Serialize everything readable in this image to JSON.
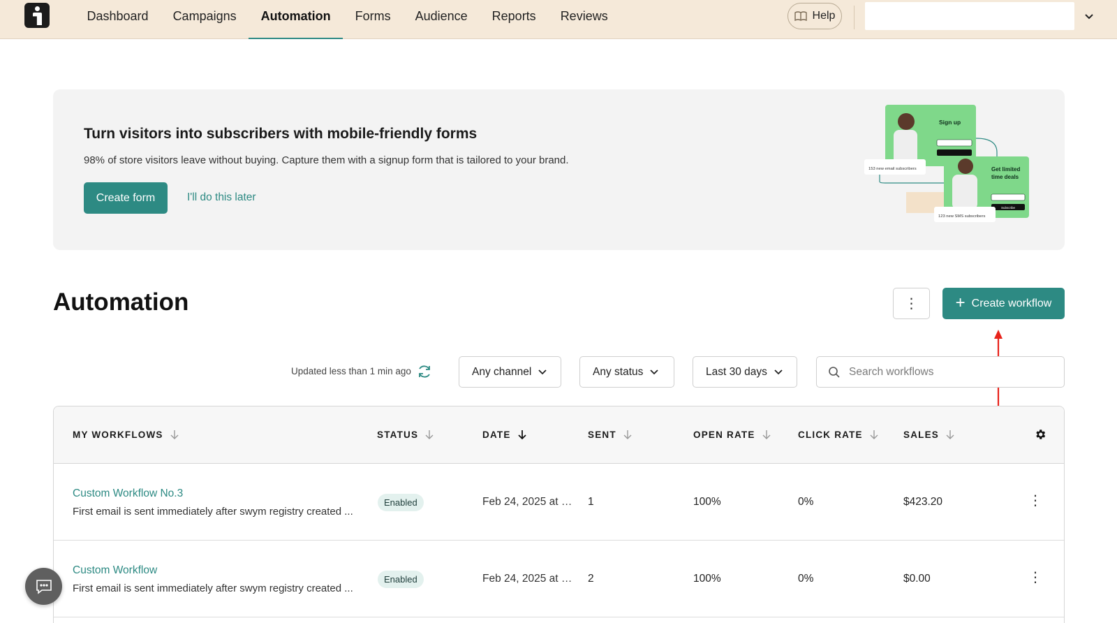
{
  "nav": {
    "items": [
      {
        "label": "Dashboard",
        "active": false
      },
      {
        "label": "Campaigns",
        "active": false
      },
      {
        "label": "Automation",
        "active": true
      },
      {
        "label": "Forms",
        "active": false
      },
      {
        "label": "Audience",
        "active": false
      },
      {
        "label": "Reports",
        "active": false
      },
      {
        "label": "Reviews",
        "active": false
      }
    ],
    "help_label": "Help",
    "accent_color": "#2d8a83"
  },
  "banner": {
    "title": "Turn visitors into subscribers with mobile-friendly forms",
    "text": "98% of store visitors leave without buying. Capture them with a signup form that is tailored to your brand.",
    "primary_button": "Create form",
    "secondary_link": "I'll do this later",
    "promo": {
      "card1_title": "Sign up",
      "card1_stat": "153 new email subscribers",
      "card2_title": "Get limited time deals",
      "card2_stat": "123 new SMS subscribers",
      "card_button": "Subscribe"
    }
  },
  "page": {
    "title": "Automation",
    "more_label": "⋮",
    "create_button": "Create workflow"
  },
  "filters": {
    "updated_text": "Updated less than 1 min ago",
    "channel": "Any channel",
    "status": "Any status",
    "date_range": "Last 30 days",
    "search_placeholder": "Search workflows"
  },
  "table": {
    "headers": {
      "name": "MY WORKFLOWS",
      "status": "STATUS",
      "date": "DATE",
      "sent": "SENT",
      "open_rate": "OPEN RATE",
      "click_rate": "CLICK RATE",
      "sales": "SALES"
    },
    "rows": [
      {
        "name": "Custom Workflow No.3",
        "description": "First email is sent immediately after swym registry created ...",
        "status": "Enabled",
        "date": "Feb 24, 2025 at 1:...",
        "sent": "1",
        "open_rate": "100%",
        "click_rate": "0%",
        "sales": "$423.20"
      },
      {
        "name": "Custom Workflow",
        "description": "First email is sent immediately after swym registry created ...",
        "status": "Enabled",
        "date": "Feb 24, 2025 at 1...",
        "sent": "2",
        "open_rate": "100%",
        "click_rate": "0%",
        "sales": "$0.00"
      }
    ]
  },
  "colors": {
    "topbar": "#f5e9d9",
    "accent": "#2d8a83",
    "annotation_arrow": "#e8231b"
  },
  "icons": [
    "help-book-icon",
    "chevron-down-icon",
    "plus-icon",
    "refresh-icon",
    "search-icon",
    "sort-arrow-icon",
    "gear-icon",
    "kebab-menu-icon",
    "chat-icon"
  ]
}
